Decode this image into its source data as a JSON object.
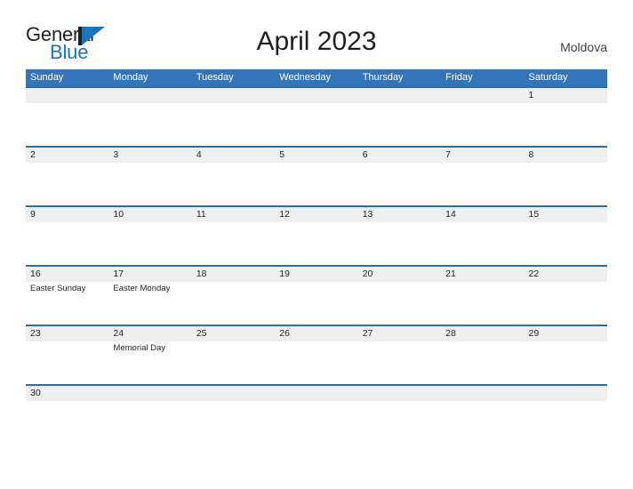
{
  "brand": {
    "word_one": "General",
    "word_two": "Blue",
    "mark_name": "general-blue-flag-logo",
    "color_dark": "#231f20",
    "color_blue": "#1b75bc"
  },
  "header": {
    "title": "April 2023",
    "country": "Moldova"
  },
  "theme": {
    "header_blue": "#3375b8",
    "row_divider_blue": "#2e6da4",
    "date_band_gray": "#efefef",
    "text_dark": "#231f20",
    "page_background": "#ffffff"
  },
  "calendar": {
    "month": "April",
    "year": "2023",
    "weekday_headers": [
      "Sunday",
      "Monday",
      "Tuesday",
      "Wednesday",
      "Thursday",
      "Friday",
      "Saturday"
    ],
    "weeks": [
      {
        "days": [
          {
            "number": "",
            "event": ""
          },
          {
            "number": "",
            "event": ""
          },
          {
            "number": "",
            "event": ""
          },
          {
            "number": "",
            "event": ""
          },
          {
            "number": "",
            "event": ""
          },
          {
            "number": "",
            "event": ""
          },
          {
            "number": "1",
            "event": ""
          }
        ]
      },
      {
        "days": [
          {
            "number": "2",
            "event": ""
          },
          {
            "number": "3",
            "event": ""
          },
          {
            "number": "4",
            "event": ""
          },
          {
            "number": "5",
            "event": ""
          },
          {
            "number": "6",
            "event": ""
          },
          {
            "number": "7",
            "event": ""
          },
          {
            "number": "8",
            "event": ""
          }
        ]
      },
      {
        "days": [
          {
            "number": "9",
            "event": ""
          },
          {
            "number": "10",
            "event": ""
          },
          {
            "number": "11",
            "event": ""
          },
          {
            "number": "12",
            "event": ""
          },
          {
            "number": "13",
            "event": ""
          },
          {
            "number": "14",
            "event": ""
          },
          {
            "number": "15",
            "event": ""
          }
        ]
      },
      {
        "days": [
          {
            "number": "16",
            "event": "Easter Sunday"
          },
          {
            "number": "17",
            "event": "Easter Monday"
          },
          {
            "number": "18",
            "event": ""
          },
          {
            "number": "19",
            "event": ""
          },
          {
            "number": "20",
            "event": ""
          },
          {
            "number": "21",
            "event": ""
          },
          {
            "number": "22",
            "event": ""
          }
        ]
      },
      {
        "days": [
          {
            "number": "23",
            "event": ""
          },
          {
            "number": "24",
            "event": "Memorial Day"
          },
          {
            "number": "25",
            "event": ""
          },
          {
            "number": "26",
            "event": ""
          },
          {
            "number": "27",
            "event": ""
          },
          {
            "number": "28",
            "event": ""
          },
          {
            "number": "29",
            "event": ""
          }
        ]
      },
      {
        "days": [
          {
            "number": "30",
            "event": ""
          },
          {
            "number": "",
            "event": ""
          },
          {
            "number": "",
            "event": ""
          },
          {
            "number": "",
            "event": ""
          },
          {
            "number": "",
            "event": ""
          },
          {
            "number": "",
            "event": ""
          },
          {
            "number": "",
            "event": ""
          }
        ]
      }
    ]
  }
}
